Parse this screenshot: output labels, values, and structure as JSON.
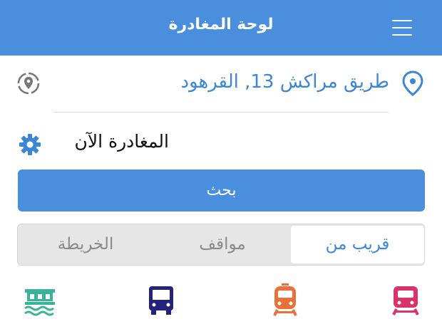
{
  "header": {
    "title": "لوحة المغادرة",
    "menu_icon": "hamburger-icon"
  },
  "location": {
    "address": "طريق مراكش 13, القرهود",
    "pin_icon": "map-pin-icon",
    "locate_icon": "locate-me-icon"
  },
  "departure": {
    "label": "المغادرة الآن",
    "settings_icon": "gear-icon"
  },
  "search": {
    "label": "بحث"
  },
  "tabs": [
    {
      "label": "قريب من",
      "selected": true
    },
    {
      "label": "مواقف",
      "selected": false
    },
    {
      "label": "الخريطة",
      "selected": false
    }
  ],
  "transport_modes": [
    {
      "icon": "metro-icon",
      "color": "#d9336a"
    },
    {
      "icon": "tram-icon",
      "color": "#e8733a"
    },
    {
      "icon": "bus-icon",
      "color": "#23237a"
    },
    {
      "icon": "water-bus-icon",
      "color": "#3bb39b"
    }
  ],
  "colors": {
    "primary": "#4a8fde",
    "link": "#3d86d6"
  }
}
